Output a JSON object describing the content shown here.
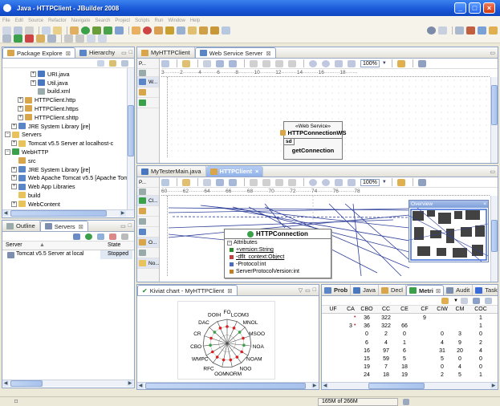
{
  "window": {
    "title": "Java - HTTPClient - JBuilder 2008",
    "controls": {
      "minimize": "_",
      "maximize": "□",
      "close": "×"
    }
  },
  "menu": [
    "File",
    "Edit",
    "Source",
    "Refactor",
    "Navigate",
    "Search",
    "Project",
    "Scripts",
    "Run",
    "Window",
    "Help"
  ],
  "package_explorer": {
    "tabs": [
      {
        "label": "Package Explore",
        "close": "⊠"
      },
      {
        "label": "Hierarchy"
      }
    ],
    "items": [
      {
        "label": "URI.java",
        "level": 4,
        "icon": "java",
        "toggle": "+"
      },
      {
        "label": "Util.java",
        "level": 4,
        "icon": "java",
        "toggle": "+"
      },
      {
        "label": "build.xml",
        "level": 4,
        "icon": "xml",
        "toggle": ""
      },
      {
        "label": "HTTPClient.http",
        "level": 2,
        "icon": "pkg",
        "toggle": "+"
      },
      {
        "label": "HTTPClient.https",
        "level": 2,
        "icon": "pkg",
        "toggle": "+"
      },
      {
        "label": "HTTPClient.shttp",
        "level": 2,
        "icon": "pkg",
        "toggle": "+"
      },
      {
        "label": "JRE System Library [jre]",
        "level": 1,
        "icon": "lib",
        "toggle": "+"
      },
      {
        "label": "Servers",
        "level": 0,
        "icon": "folder",
        "toggle": "−"
      },
      {
        "label": "Tomcat v5.5 Server at localhost-c",
        "level": 1,
        "icon": "folder",
        "toggle": "+"
      },
      {
        "label": "WebHTTP",
        "level": 0,
        "icon": "project",
        "toggle": "−"
      },
      {
        "label": "src",
        "level": 1,
        "icon": "pkg",
        "toggle": ""
      },
      {
        "label": "JRE System Library [jre]",
        "level": 1,
        "icon": "lib",
        "toggle": "+"
      },
      {
        "label": "Web Apache Tomcat v5.5 [Apache Tom",
        "level": 1,
        "icon": "lib",
        "toggle": "+"
      },
      {
        "label": "Web App Libraries",
        "level": 1,
        "icon": "lib",
        "toggle": "+"
      },
      {
        "label": "build",
        "level": 1,
        "icon": "folder",
        "toggle": ""
      },
      {
        "label": "WebContent",
        "level": 1,
        "icon": "folder",
        "toggle": "+"
      }
    ]
  },
  "servers_view": {
    "tabs": [
      {
        "label": "Outline"
      },
      {
        "label": "Servers",
        "close": "⊠"
      }
    ],
    "columns": [
      "Server",
      "State"
    ],
    "rows": [
      {
        "server": "Tomcat v5.5 Server at local",
        "state": "Stopped"
      }
    ]
  },
  "editor_top": {
    "tabs": [
      {
        "label": "MyHTTPClient"
      },
      {
        "label": "Web Service Server",
        "close": "⊠"
      }
    ],
    "palette": [
      {
        "label": "P..."
      },
      {
        "label": "W..."
      }
    ],
    "ruler": "3·········2·········4·········6·········8·········10·········12·········14·········16·········18·······",
    "zoom": "100%",
    "ws_box": {
      "stereotype": "«Web Service»",
      "name": "HTTPConnectionWS",
      "tag": "sd",
      "operation": "getConnection"
    }
  },
  "editor_mid": {
    "tabs": [
      {
        "label": "MyTesterMain.java"
      },
      {
        "label": "HTTPClient",
        "close": "×"
      }
    ],
    "palette": [
      {
        "label": "P..."
      },
      {
        "label": "Cl..."
      },
      {
        "label": "O..."
      },
      {
        "label": "No..."
      }
    ],
    "ruler": "60·········62·········64·········66·········68·········70·········72·········74·········76·········78",
    "zoom": "100%",
    "class_box": {
      "name": "HTTPConnection",
      "section": "Attributes",
      "attributes": [
        "+version:String",
        "-dflt_context:Object",
        "-Protocol:int",
        "ServerProtocolVersion:int"
      ]
    },
    "overview_label": "Overview"
  },
  "kiviat": {
    "title": "Kiviat chart - MyHTTPClient",
    "close": "⊠",
    "axes": [
      "FO",
      "LCOM3",
      "MNOL",
      "MSOO",
      "NOA",
      "NOAM",
      "NOO",
      "NORM",
      "OOM",
      "RFC",
      "WMPC",
      "CBO",
      "CR",
      "DAC",
      "DOIH"
    ]
  },
  "metrics": {
    "tabs": [
      {
        "label": "Prob"
      },
      {
        "label": "Java"
      },
      {
        "label": "Decl"
      },
      {
        "label": "Metri",
        "close": "⊠"
      },
      {
        "label": "Audit"
      },
      {
        "label": "Task"
      }
    ],
    "columns": [
      "UF",
      "CA",
      "CBO",
      "CC",
      "CE",
      "CF",
      "CIW",
      "CM",
      "COC"
    ],
    "rows": [
      [
        "",
        "",
        "36",
        "322",
        "",
        "9",
        "",
        "",
        "1"
      ],
      [
        "",
        "3",
        "36",
        "322",
        "66",
        "",
        "",
        "",
        "1"
      ],
      [
        "",
        "",
        "0",
        "2",
        "0",
        "",
        "0",
        "3",
        "0"
      ],
      [
        "",
        "",
        "6",
        "4",
        "1",
        "",
        "4",
        "9",
        "2"
      ],
      [
        "",
        "",
        "16",
        "97",
        "6",
        "",
        "31",
        "20",
        "4"
      ],
      [
        "",
        "",
        "15",
        "59",
        "5",
        "",
        "5",
        "0",
        "0"
      ],
      [
        "",
        "",
        "19",
        "7",
        "18",
        "",
        "0",
        "4",
        "0"
      ],
      [
        "",
        "",
        "24",
        "18",
        "19",
        "",
        "2",
        "5",
        "1"
      ]
    ]
  },
  "status": {
    "memory": "165M of 266M"
  }
}
